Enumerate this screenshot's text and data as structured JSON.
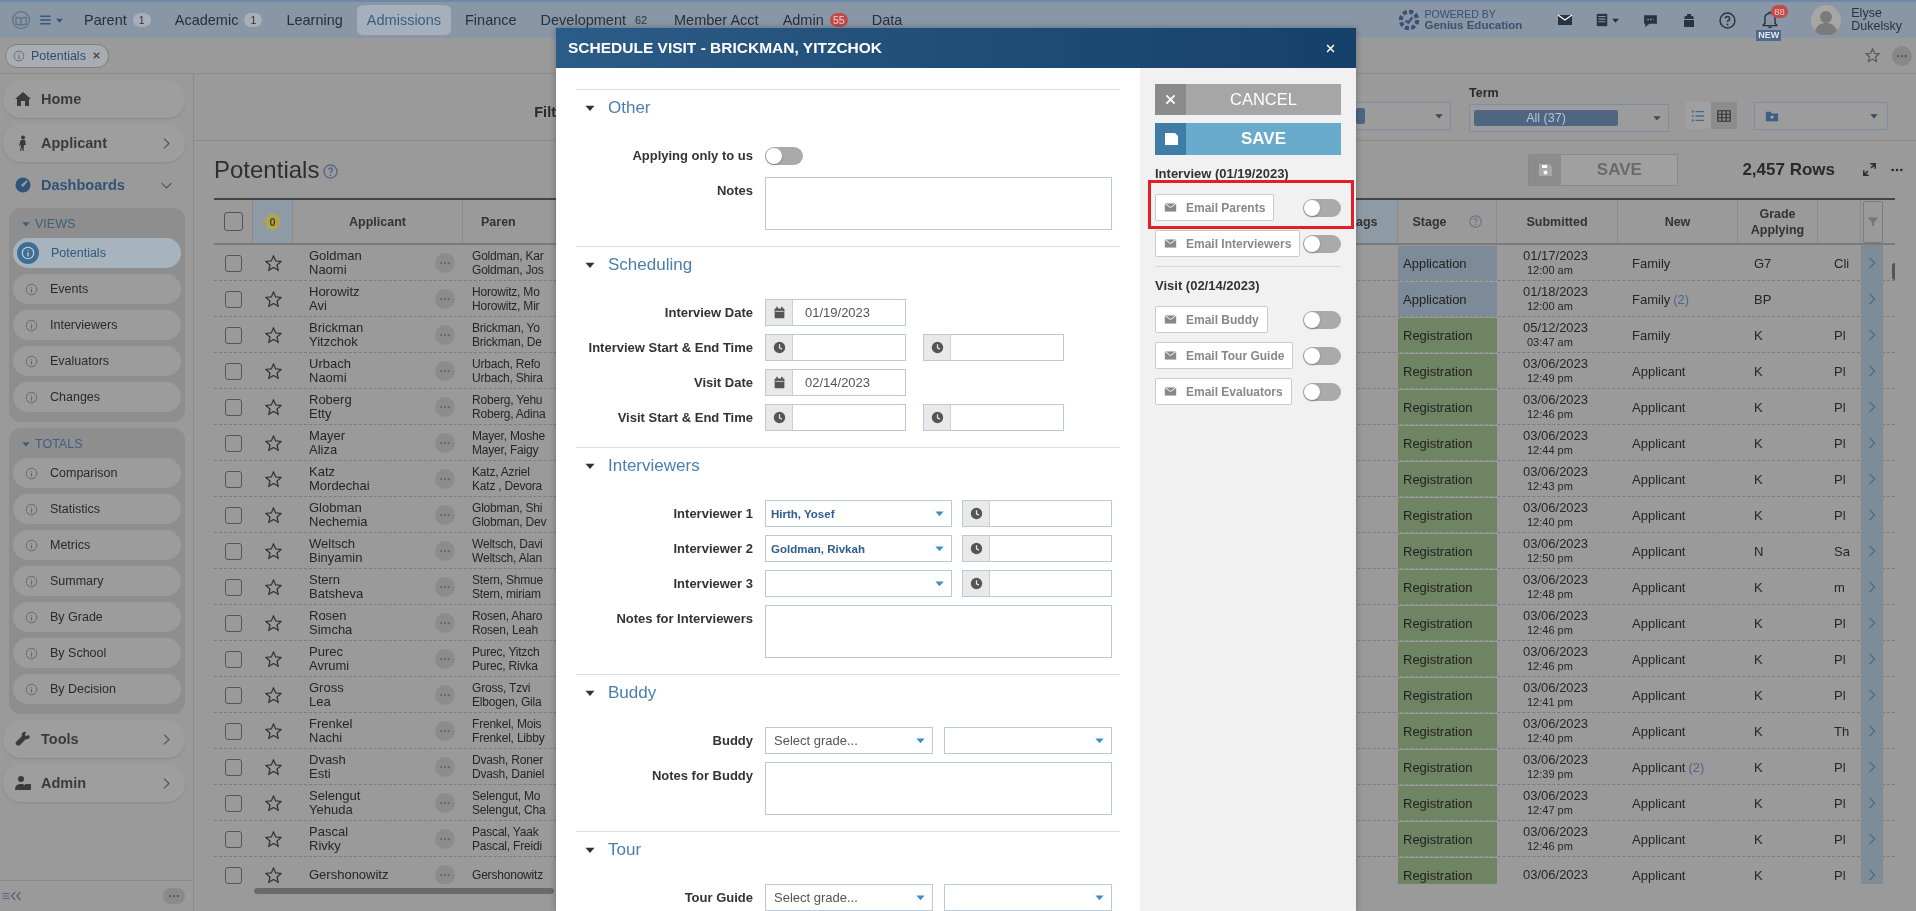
{
  "top_nav": {
    "items": [
      {
        "label": "Parent",
        "badge": {
          "text": "1",
          "color": "#a8afb8"
        },
        "selected": false
      },
      {
        "label": "Academic",
        "badge": {
          "text": "1",
          "color": "#a8afb8"
        },
        "selected": false
      },
      {
        "label": "Learning",
        "selected": false
      },
      {
        "label": "Admissions",
        "selected": true
      },
      {
        "label": "Finance",
        "selected": false
      },
      {
        "label": "Development",
        "badge": {
          "text": "62"
        },
        "selected": false
      },
      {
        "label": "Member Acct",
        "selected": false
      },
      {
        "label": "Admin",
        "badge": {
          "text": "55",
          "color": "#c24a4a"
        },
        "selected": false
      },
      {
        "label": "Data",
        "selected": false
      }
    ],
    "powered_by": "POWERED BY",
    "brand": "Genius Education",
    "notifications": "88",
    "new_label": "NEW",
    "user_first": "Elyse",
    "user_last": "Dukelsky"
  },
  "open_tabs": [
    {
      "label": "Potentials",
      "selected": true
    }
  ],
  "sidebar": {
    "items": [
      {
        "label": "Home",
        "kind": "link"
      },
      {
        "label": "Applicant",
        "kind": "menu",
        "expanded": false
      },
      {
        "label": "Dashboards",
        "kind": "menu",
        "expanded": true,
        "groups": [
          {
            "title": "VIEWS",
            "expanded": true,
            "items": [
              {
                "label": "Potentials",
                "selected": true
              },
              {
                "label": "Events",
                "selected": false
              },
              {
                "label": "Interviewers",
                "selected": false
              },
              {
                "label": "Evaluators",
                "selected": false
              },
              {
                "label": "Changes",
                "selected": false
              }
            ]
          },
          {
            "title": "TOTALS",
            "expanded": true,
            "items": [
              {
                "label": "Comparison",
                "selected": false
              },
              {
                "label": "Statistics",
                "selected": false
              },
              {
                "label": "Metrics",
                "selected": false
              },
              {
                "label": "Summary",
                "selected": false
              },
              {
                "label": "By Grade",
                "selected": false
              },
              {
                "label": "By School",
                "selected": false
              },
              {
                "label": "By Decision",
                "selected": false
              }
            ]
          }
        ]
      },
      {
        "label": "Tools",
        "kind": "menu",
        "expanded": false
      },
      {
        "label": "Admin",
        "kind": "menu",
        "expanded": false
      }
    ]
  },
  "filters": {
    "label": "Filt",
    "term_label": "Term",
    "term_value": "All (37)",
    "views": [
      {
        "kind": "list",
        "selected": true
      },
      {
        "kind": "grid",
        "selected": false
      }
    ]
  },
  "page": {
    "title": "Potentials",
    "save": "SAVE",
    "save_disabled": true,
    "row_count": "2,457 Rows"
  },
  "table": {
    "all_checked": false,
    "starred_count": "0",
    "columns_left": [
      "Applicant",
      "Paren"
    ],
    "columns_right": [
      "ags",
      "Stage",
      "Submitted",
      "New",
      "Grade Applying"
    ],
    "rows": [
      {
        "checked": false,
        "starred": false,
        "last": "Goldman",
        "first": "Naomi",
        "parent_1": "Goldman, Kar",
        "parent_2": "Goldman, Jos",
        "stage": "Application",
        "color": "#7d8b99",
        "date": "01/17/2023",
        "time": "12:00 am",
        "new": "Family",
        "grade": "G7",
        "column_8": "Cli"
      },
      {
        "checked": false,
        "starred": false,
        "last": "Horowitz",
        "first": "Avi",
        "parent_1": "Horowitz, Mo",
        "parent_2": "Horowitz, Mir",
        "stage": "Application",
        "color": "#7d8b99",
        "date": "01/18/2023",
        "time": "12:00 am",
        "new": "Family",
        "new_count": "(2)",
        "grade": "BP"
      },
      {
        "checked": false,
        "starred": false,
        "last": "Brickman",
        "first": "Yitzchok",
        "parent_1": "Brickman, Yo",
        "parent_2": "Brickman, De",
        "stage": "Registration",
        "color": "#6e8462",
        "date": "05/12/2023",
        "time": "03:47 am",
        "new": "Family",
        "grade": "K",
        "column_8": "Pl"
      },
      {
        "checked": false,
        "starred": false,
        "last": "Urbach",
        "first": "Naomi",
        "parent_1": "Urbach, Refo",
        "parent_2": "Urbach, Shira",
        "stage": "Registration",
        "color": "#6e8462",
        "date": "03/06/2023",
        "time": "12:49 pm",
        "new": "Applicant",
        "grade": "K",
        "column_8": "Pl"
      },
      {
        "checked": false,
        "starred": false,
        "last": "Roberg",
        "first": "Etty",
        "parent_1": "Roberg, Yehu",
        "parent_2": "Roberg, Adina",
        "stage": "Registration",
        "color": "#6e8462",
        "date": "03/06/2023",
        "time": "12:46 pm",
        "new": "Applicant",
        "grade": "K",
        "column_8": "Pl"
      },
      {
        "checked": false,
        "starred": false,
        "last": "Mayer",
        "first": "Aliza",
        "parent_1": "Mayer, Moshe",
        "parent_2": "Mayer, Faigy",
        "stage": "Registration",
        "color": "#6e8462",
        "date": "03/06/2023",
        "time": "12:44 pm",
        "new": "Applicant",
        "grade": "K",
        "column_8": "Pl"
      },
      {
        "checked": false,
        "starred": false,
        "last": "Katz",
        "first": "Mordechai",
        "parent_1": "Katz, Azriel",
        "parent_2": "Katz , Devora",
        "stage": "Registration",
        "color": "#6e8462",
        "date": "03/06/2023",
        "time": "12:43 pm",
        "new": "Applicant",
        "grade": "K",
        "column_8": "Pl"
      },
      {
        "checked": false,
        "starred": false,
        "last": "Globman",
        "first": "Nechemia",
        "parent_1": "Globman, Shi",
        "parent_2": "Globman, Dev",
        "stage": "Registration",
        "color": "#6e8462",
        "date": "03/06/2023",
        "time": "12:40 pm",
        "new": "Applicant",
        "grade": "K",
        "column_8": "Pl"
      },
      {
        "checked": false,
        "starred": false,
        "last": "Weltsch",
        "first": "Binyamin",
        "parent_1": "Weltsch, Davi",
        "parent_2": "Weltsch, Alan",
        "stage": "Registration",
        "color": "#6e8462",
        "date": "03/06/2023",
        "time": "12:50 pm",
        "new": "Applicant",
        "grade": "N",
        "column_8": "Sa"
      },
      {
        "checked": false,
        "starred": false,
        "last": "Stern",
        "first": "Batsheva",
        "parent_1": "Stern, Shmue",
        "parent_2": "Stern, miriam",
        "stage": "Registration",
        "color": "#6e8462",
        "date": "03/06/2023",
        "time": "12:48 pm",
        "new": "Applicant",
        "grade": "K",
        "column_8": "m"
      },
      {
        "checked": false,
        "starred": false,
        "last": "Rosen",
        "first": "Simcha",
        "parent_1": "Rosen, Aharo",
        "parent_2": "Rosen, Leah",
        "stage": "Registration",
        "color": "#6e8462",
        "date": "03/06/2023",
        "time": "12:46 pm",
        "new": "Applicant",
        "grade": "K",
        "column_8": "Pl"
      },
      {
        "checked": false,
        "starred": false,
        "last": "Purec",
        "first": "Avrumi",
        "parent_1": "Purec, Yitzch",
        "parent_2": "Purec, Rivka",
        "stage": "Registration",
        "color": "#6e8462",
        "date": "03/06/2023",
        "time": "12:46 pm",
        "new": "Applicant",
        "grade": "K",
        "column_8": "Pl"
      },
      {
        "checked": false,
        "starred": false,
        "last": "Gross",
        "first": "Lea",
        "parent_1": "Gross, Tzvi",
        "parent_2": "Elbogen, Gila",
        "stage": "Registration",
        "color": "#6e8462",
        "date": "03/06/2023",
        "time": "12:41 pm",
        "new": "Applicant",
        "grade": "K",
        "column_8": "Pl"
      },
      {
        "checked": false,
        "starred": false,
        "last": "Frenkel",
        "first": "Nachi",
        "parent_1": "Frenkel, Mois",
        "parent_2": "Frenkel, Libby",
        "stage": "Registration",
        "color": "#6e8462",
        "date": "03/06/2023",
        "time": "12:40 pm",
        "new": "Applicant",
        "grade": "K",
        "column_8": "Th"
      },
      {
        "checked": false,
        "starred": false,
        "last": "Dvash",
        "first": "Esti",
        "parent_1": "Dvash, Roner",
        "parent_2": "Dvash, Daniel",
        "stage": "Registration",
        "color": "#6e8462",
        "date": "03/06/2023",
        "time": "12:39 pm",
        "new": "Applicant",
        "new_count": "(2)",
        "grade": "K",
        "column_8": "Pl"
      },
      {
        "checked": false,
        "starred": false,
        "last": "Selengut",
        "first": "Yehuda",
        "parent_1": "Selengut, Mo",
        "parent_2": "Selengut, Cha",
        "stage": "Registration",
        "color": "#6e8462",
        "date": "03/06/2023",
        "time": "12:47 pm",
        "new": "Applicant",
        "grade": "K",
        "column_8": "Pl"
      },
      {
        "checked": false,
        "starred": false,
        "last": "Pascal",
        "first": "Rivky",
        "parent_1": "Pascal, Yaak",
        "parent_2": "Pascal, Freidi",
        "stage": "Registration",
        "color": "#6e8462",
        "date": "03/06/2023",
        "time": "12:46 pm",
        "new": "Applicant",
        "grade": "K",
        "column_8": "Pl"
      },
      {
        "checked": false,
        "starred": false,
        "last": "Gershonowitz",
        "parent_1": "Gershonowitz",
        "stage": "Registration",
        "color": "#6e8462",
        "date": "03/06/2023",
        "new": "Applicant",
        "grade": "K",
        "column_8": "Pl"
      }
    ]
  },
  "modal": {
    "title": "SCHEDULE VISIT - BRICKMAN, YITZCHOK",
    "sections": [
      {
        "title": "Other",
        "expanded": true,
        "fields": [
          {
            "kind": "toggle",
            "label": "Applying only to us",
            "on": false
          },
          {
            "kind": "textarea",
            "label": "Notes"
          }
        ]
      },
      {
        "title": "Scheduling",
        "expanded": true,
        "fields": [
          {
            "kind": "date",
            "label": "Interview Date",
            "value": "01/19/2023"
          },
          {
            "kind": "time_range",
            "label": "Interview Start & End Time"
          },
          {
            "kind": "date",
            "label": "Visit Date",
            "value": "02/14/2023"
          },
          {
            "kind": "time_range",
            "label": "Visit Start & End Time"
          }
        ]
      },
      {
        "title": "Interviewers",
        "expanded": true,
        "fields": [
          {
            "kind": "select_time",
            "label": "Interviewer 1",
            "value": "Hirth, Yosef"
          },
          {
            "kind": "select_time",
            "label": "Interviewer 2",
            "value": "Goldman, Rivkah"
          },
          {
            "kind": "select_time",
            "label": "Interviewer 3"
          },
          {
            "kind": "textarea",
            "label": "Notes for Interviewers"
          }
        ]
      },
      {
        "title": "Buddy",
        "expanded": true,
        "fields": [
          {
            "kind": "select_pair",
            "label": "Buddy",
            "placeholder": "Select grade..."
          },
          {
            "kind": "textarea",
            "label": "Notes for Buddy"
          }
        ]
      },
      {
        "title": "Tour",
        "expanded": true,
        "fields": [
          {
            "kind": "select_pair",
            "label": "Tour Guide",
            "placeholder": "Select grade..."
          }
        ]
      }
    ],
    "cancel": "CANCEL",
    "save": "SAVE",
    "groups": [
      {
        "title": "Interview (01/19/2023)",
        "actions": [
          {
            "label": "Email Parents",
            "on": false,
            "highlighted": true
          },
          {
            "label": "Email Interviewers",
            "on": false,
            "highlighted": false
          }
        ]
      },
      {
        "title": "Visit (02/14/2023)",
        "actions": [
          {
            "label": "Email Buddy",
            "on": false,
            "highlighted": false
          },
          {
            "label": "Email Tour Guide",
            "on": false,
            "highlighted": false
          },
          {
            "label": "Email Evaluators",
            "on": false,
            "highlighted": false
          }
        ]
      }
    ]
  }
}
